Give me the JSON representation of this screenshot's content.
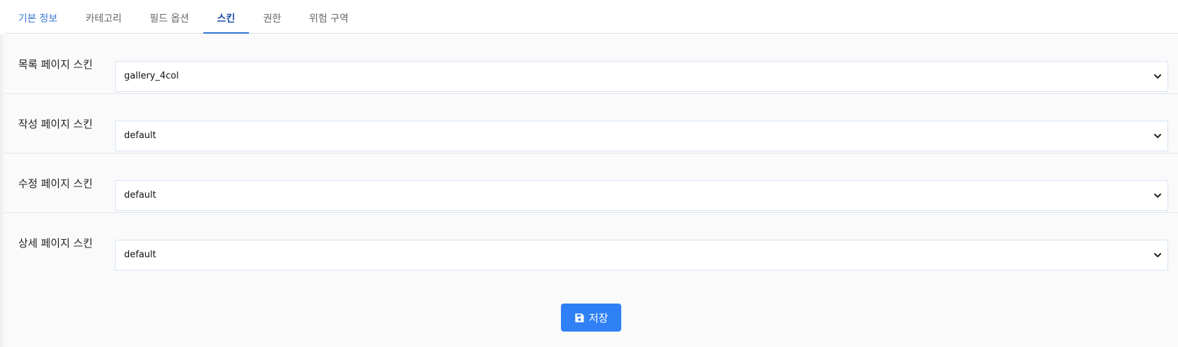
{
  "tabs": [
    {
      "label": "기본 정보"
    },
    {
      "label": "카테고리"
    },
    {
      "label": "필드 옵션"
    },
    {
      "label": "스킨"
    },
    {
      "label": "권한"
    },
    {
      "label": "위험 구역"
    }
  ],
  "active_tab": "스킨",
  "form": {
    "rows": [
      {
        "label": "목록 페이지 스킨",
        "value": "gallery_4col"
      },
      {
        "label": "작성 페이지 스킨",
        "value": "default"
      },
      {
        "label": "수정 페이지 스킨",
        "value": "default"
      },
      {
        "label": "상세 페이지 스킨",
        "value": "default"
      }
    ]
  },
  "save_button": {
    "label": "저장",
    "icon": "save-icon"
  },
  "colors": {
    "accent": "#2f80f5",
    "active_tab": "#1e4fa3",
    "tab_primary": "#3a7bd5"
  }
}
